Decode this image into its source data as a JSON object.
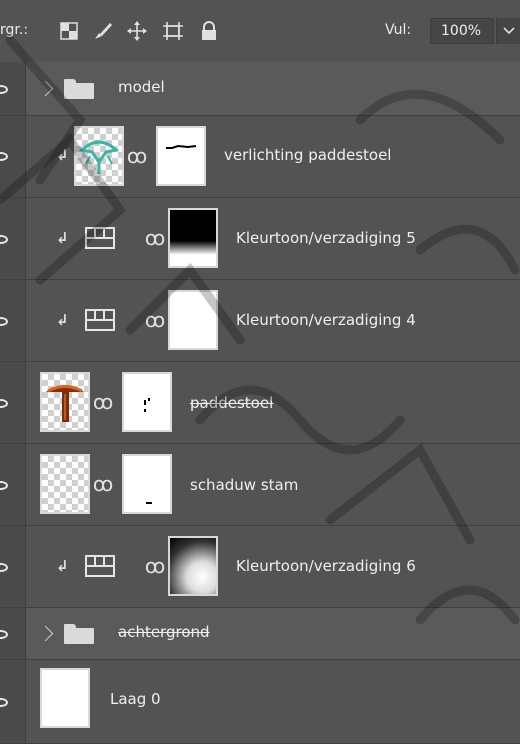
{
  "toolbar": {
    "lock_label": "rgr.:",
    "fill_label": "Vul:",
    "fill_value": "100%",
    "icons": [
      "lock-transparent-pixels-icon",
      "lock-image-pixels-icon",
      "lock-position-icon",
      "lock-artboard-icon",
      "lock-all-icon",
      "dropdown-arrow-icon"
    ]
  },
  "layers": [
    {
      "name": "model",
      "kind": "group",
      "collapsed": true
    },
    {
      "name": "verlichting paddestoel",
      "kind": "pixel-with-mask",
      "clipped": true
    },
    {
      "name": "Kleurtoon/verzadiging 5",
      "kind": "adjustment",
      "clipped": true
    },
    {
      "name": "Kleurtoon/verzadiging 4",
      "kind": "adjustment",
      "clipped": true
    },
    {
      "name": "paddestoel",
      "kind": "pixel-with-mask",
      "clipped": false
    },
    {
      "name": "schaduw stam",
      "kind": "pixel-with-mask",
      "clipped": false
    },
    {
      "name": "Kleurtoon/verzadiging 6",
      "kind": "adjustment",
      "clipped": true
    },
    {
      "name": "achtergrond",
      "kind": "group",
      "collapsed": true
    },
    {
      "name": "Laag 0",
      "kind": "pixel",
      "clipped": false
    }
  ],
  "colors": {
    "panel_bg": "#535353",
    "group_bg": "#5a5a5a",
    "text": "#efefef",
    "watermark": "#000000"
  }
}
